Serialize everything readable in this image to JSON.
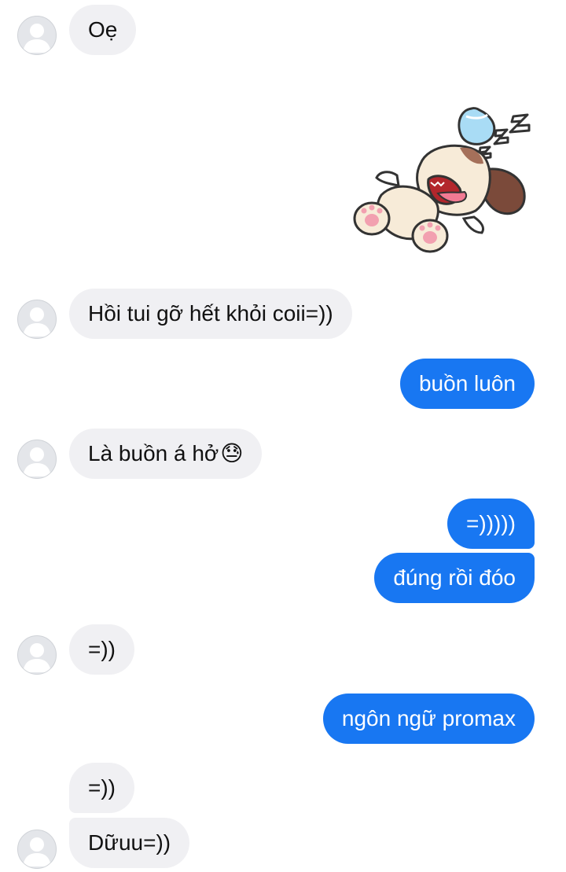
{
  "colors": {
    "incoming_bg": "#f0f0f3",
    "outgoing_bg": "#1877f2",
    "incoming_text": "#111111",
    "outgoing_text": "#ffffff"
  },
  "messages": [
    {
      "id": "m1",
      "sender": "other",
      "text": "Oẹ"
    },
    {
      "id": "m2",
      "sender": "other",
      "type": "sticker",
      "sticker": "sleeping-dog-sticker"
    },
    {
      "id": "m3",
      "sender": "other",
      "text": "Hồi tui gỡ hết khỏi coii=))"
    },
    {
      "id": "m4",
      "sender": "me",
      "text": "buồn luôn"
    },
    {
      "id": "m5",
      "sender": "other",
      "text": "Là buồn á hở",
      "emoji": "😓"
    },
    {
      "id": "m6",
      "sender": "me",
      "text": "=)))))"
    },
    {
      "id": "m7",
      "sender": "me",
      "text": "đúng rồi đóo"
    },
    {
      "id": "m8",
      "sender": "other",
      "text": "=))"
    },
    {
      "id": "m9",
      "sender": "me",
      "text": "ngôn ngữ promax"
    },
    {
      "id": "m10",
      "sender": "other",
      "text": "=))"
    },
    {
      "id": "m11",
      "sender": "other",
      "text": "Dữuu=))"
    }
  ]
}
